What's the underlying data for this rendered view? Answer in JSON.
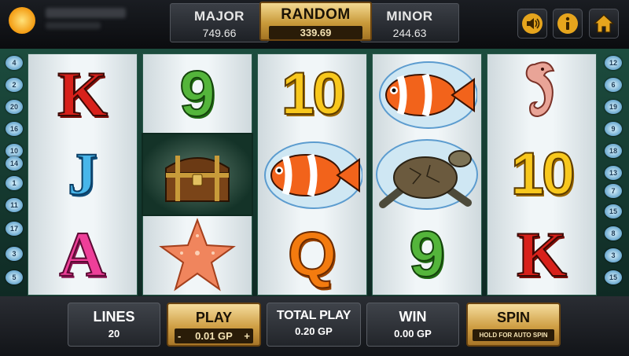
{
  "jackpots": {
    "major": {
      "label": "MAJOR",
      "value": "749.66"
    },
    "random": {
      "label": "RANDOM",
      "value": "339.69"
    },
    "minor": {
      "label": "MINOR",
      "value": "244.63"
    }
  },
  "toolbar": {
    "icons": [
      "speaker-icon",
      "info-icon",
      "home-icon"
    ]
  },
  "paylines": {
    "left": [
      "4",
      "2",
      "20",
      "16",
      "10",
      "14",
      "1",
      "11",
      "17",
      "3",
      "5"
    ],
    "right": [
      "12",
      "6",
      "19",
      "9",
      "18",
      "13",
      "7",
      "15",
      "8",
      "3",
      "15"
    ]
  },
  "reels": [
    {
      "symbols": [
        "K",
        "J",
        "A"
      ]
    },
    {
      "symbols": [
        "9",
        "treasure-chest",
        "starfish"
      ]
    },
    {
      "symbols": [
        "10",
        "clownfish",
        "Q"
      ]
    },
    {
      "symbols": [
        "clownfish",
        "sea-turtle",
        "9"
      ]
    },
    {
      "symbols": [
        "seahorse",
        "10",
        "K"
      ]
    }
  ],
  "controls": {
    "lines": {
      "label": "LINES",
      "value": "20"
    },
    "play": {
      "label": "PLAY",
      "value": "0.01 GP",
      "minus": "-",
      "plus": "+"
    },
    "total_play": {
      "label": "TOTAL PLAY",
      "value": "0.20 GP"
    },
    "win": {
      "label": "WIN",
      "value": "0.00 GP"
    },
    "spin": {
      "label": "SPIN",
      "hint": "HOLD FOR AUTO SPIN"
    }
  },
  "colors": {
    "accent_gold": "#cf9f45",
    "reel_bg": "#f1f6f8",
    "frame_green": "#1c4c3e"
  }
}
